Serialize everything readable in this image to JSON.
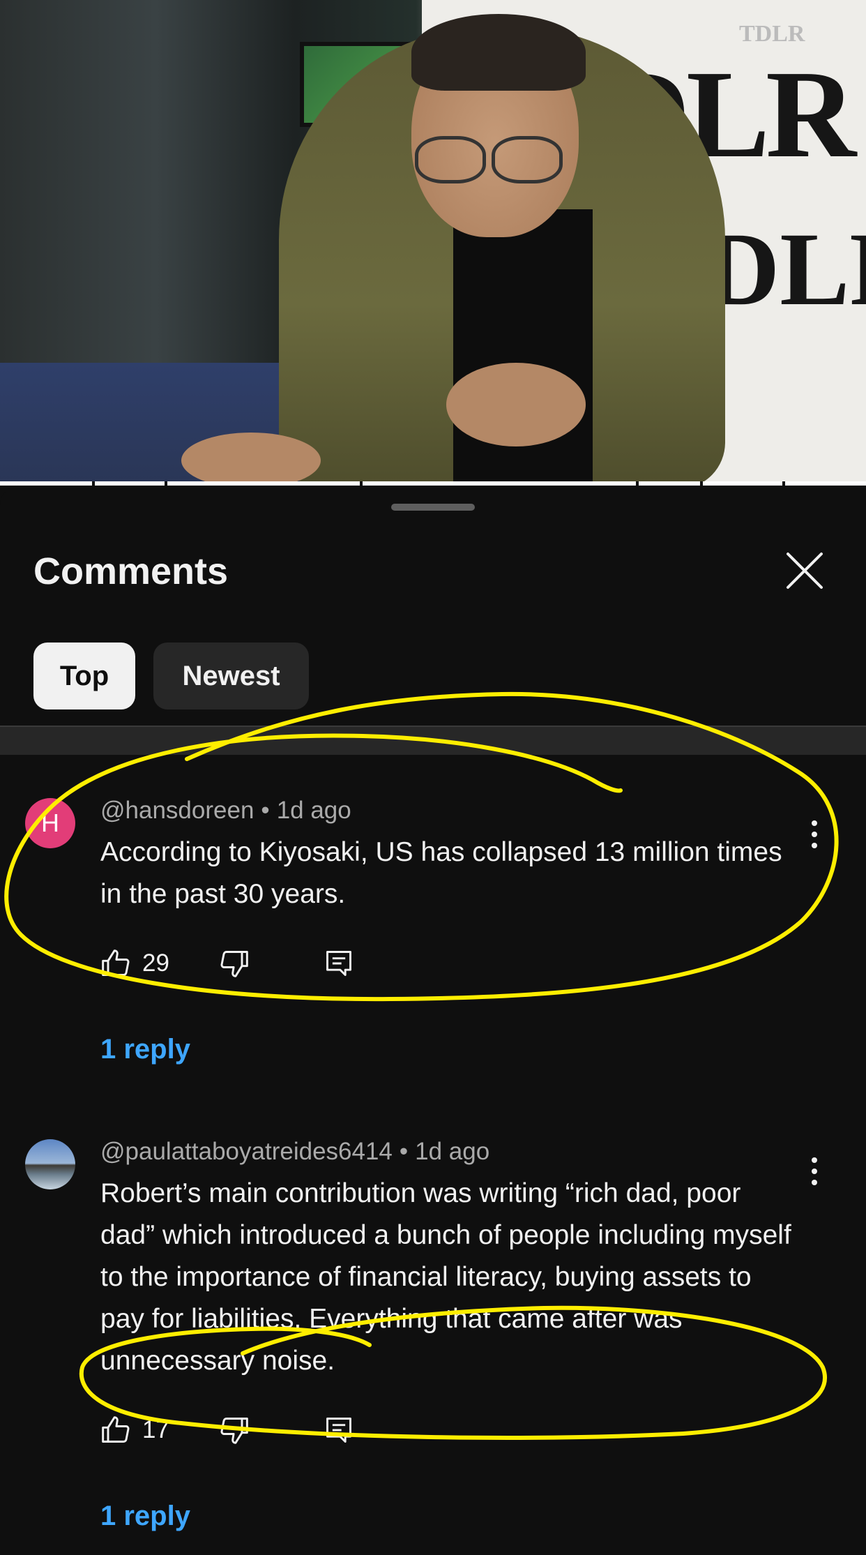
{
  "video": {
    "banner_logo_large": "DLR",
    "banner_logo_small": "TDLR"
  },
  "sheet": {
    "title": "Comments",
    "close_icon": "close-icon",
    "filters": [
      {
        "label": "Top",
        "selected": true
      },
      {
        "label": "Newest",
        "selected": false
      }
    ]
  },
  "comments": [
    {
      "avatar_letter": "H",
      "author": "@hansdoreen",
      "separator": "•",
      "time": "1d ago",
      "text": "According to Kiyosaki, US has collapsed 13 million times in the past 30 years.",
      "likes": "29",
      "reply_label": "1 reply"
    },
    {
      "avatar_letter": "",
      "author": "@paulattaboyatreides6414",
      "separator": "•",
      "time": "1d ago",
      "text": "Robert’s main contribution was writing “rich dad, poor dad” which introduced a bunch of people including myself to the importance of financial literacy, buying assets to pay for liabilities. Everything that came after was unnecessary noise.",
      "likes": "17",
      "reply_label": "1 reply"
    }
  ],
  "colors": {
    "background": "#0f0f0f",
    "accent_link": "#3ea6ff",
    "chip_selected": "#f1f1f1",
    "chip_unselected": "#272727",
    "annotation": "#ffee00"
  }
}
